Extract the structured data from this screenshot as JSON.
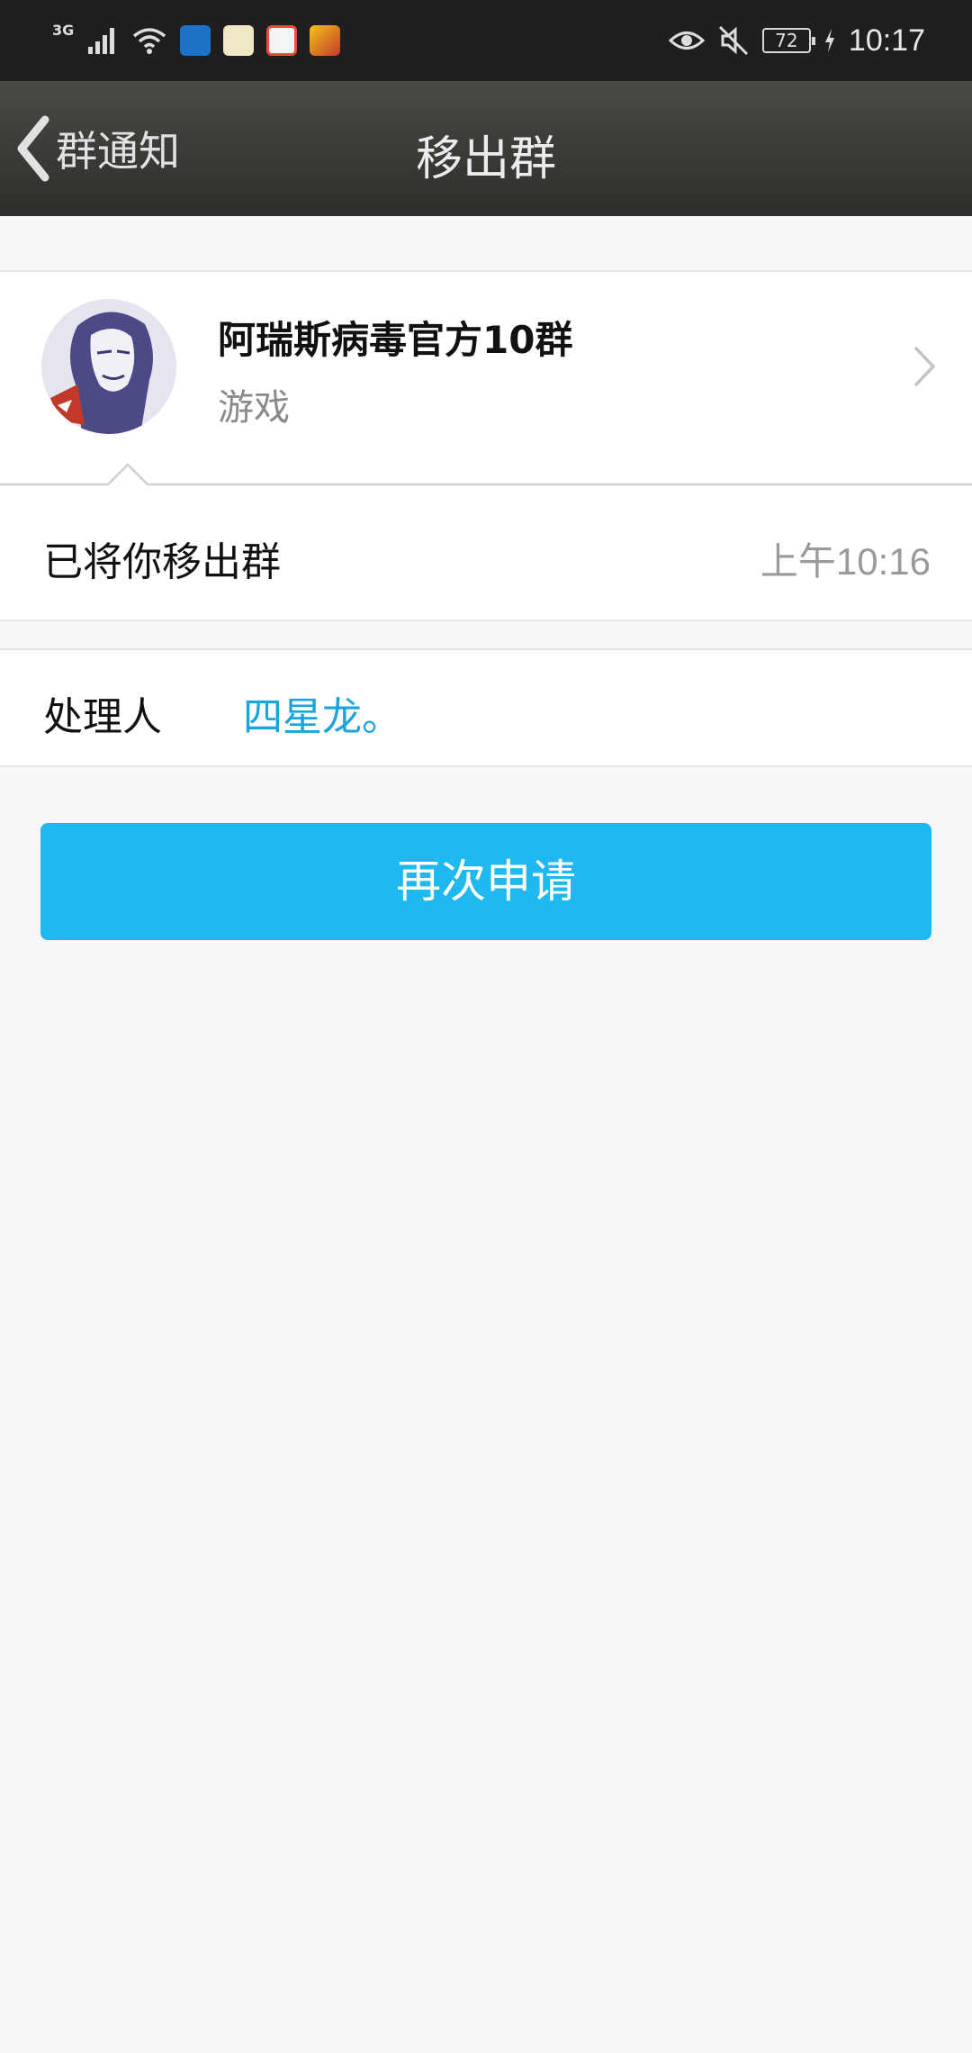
{
  "status_bar": {
    "network_type": "3G",
    "battery_level": "72",
    "time": "10:17",
    "icons": [
      "signal-icon",
      "wifi-icon",
      "shield-app-icon",
      "app-icon",
      "maps-icon",
      "game-app-icon",
      "eye-icon",
      "mute-icon",
      "battery-icon",
      "charging-icon"
    ]
  },
  "nav": {
    "back_label": "群通知",
    "title": "移出群"
  },
  "group": {
    "name": "阿瑞斯病毒官方10群",
    "category": "游戏"
  },
  "notice": {
    "text": "已将你移出群",
    "time": "上午10:16"
  },
  "handler": {
    "label": "处理人",
    "name": "四星龙。"
  },
  "actions": {
    "reapply_label": "再次申请"
  },
  "colors": {
    "accent": "#1fb8ef",
    "link": "#1aa3dc",
    "background": "#f7f7f9",
    "nav_bar": "#3b3a37"
  }
}
